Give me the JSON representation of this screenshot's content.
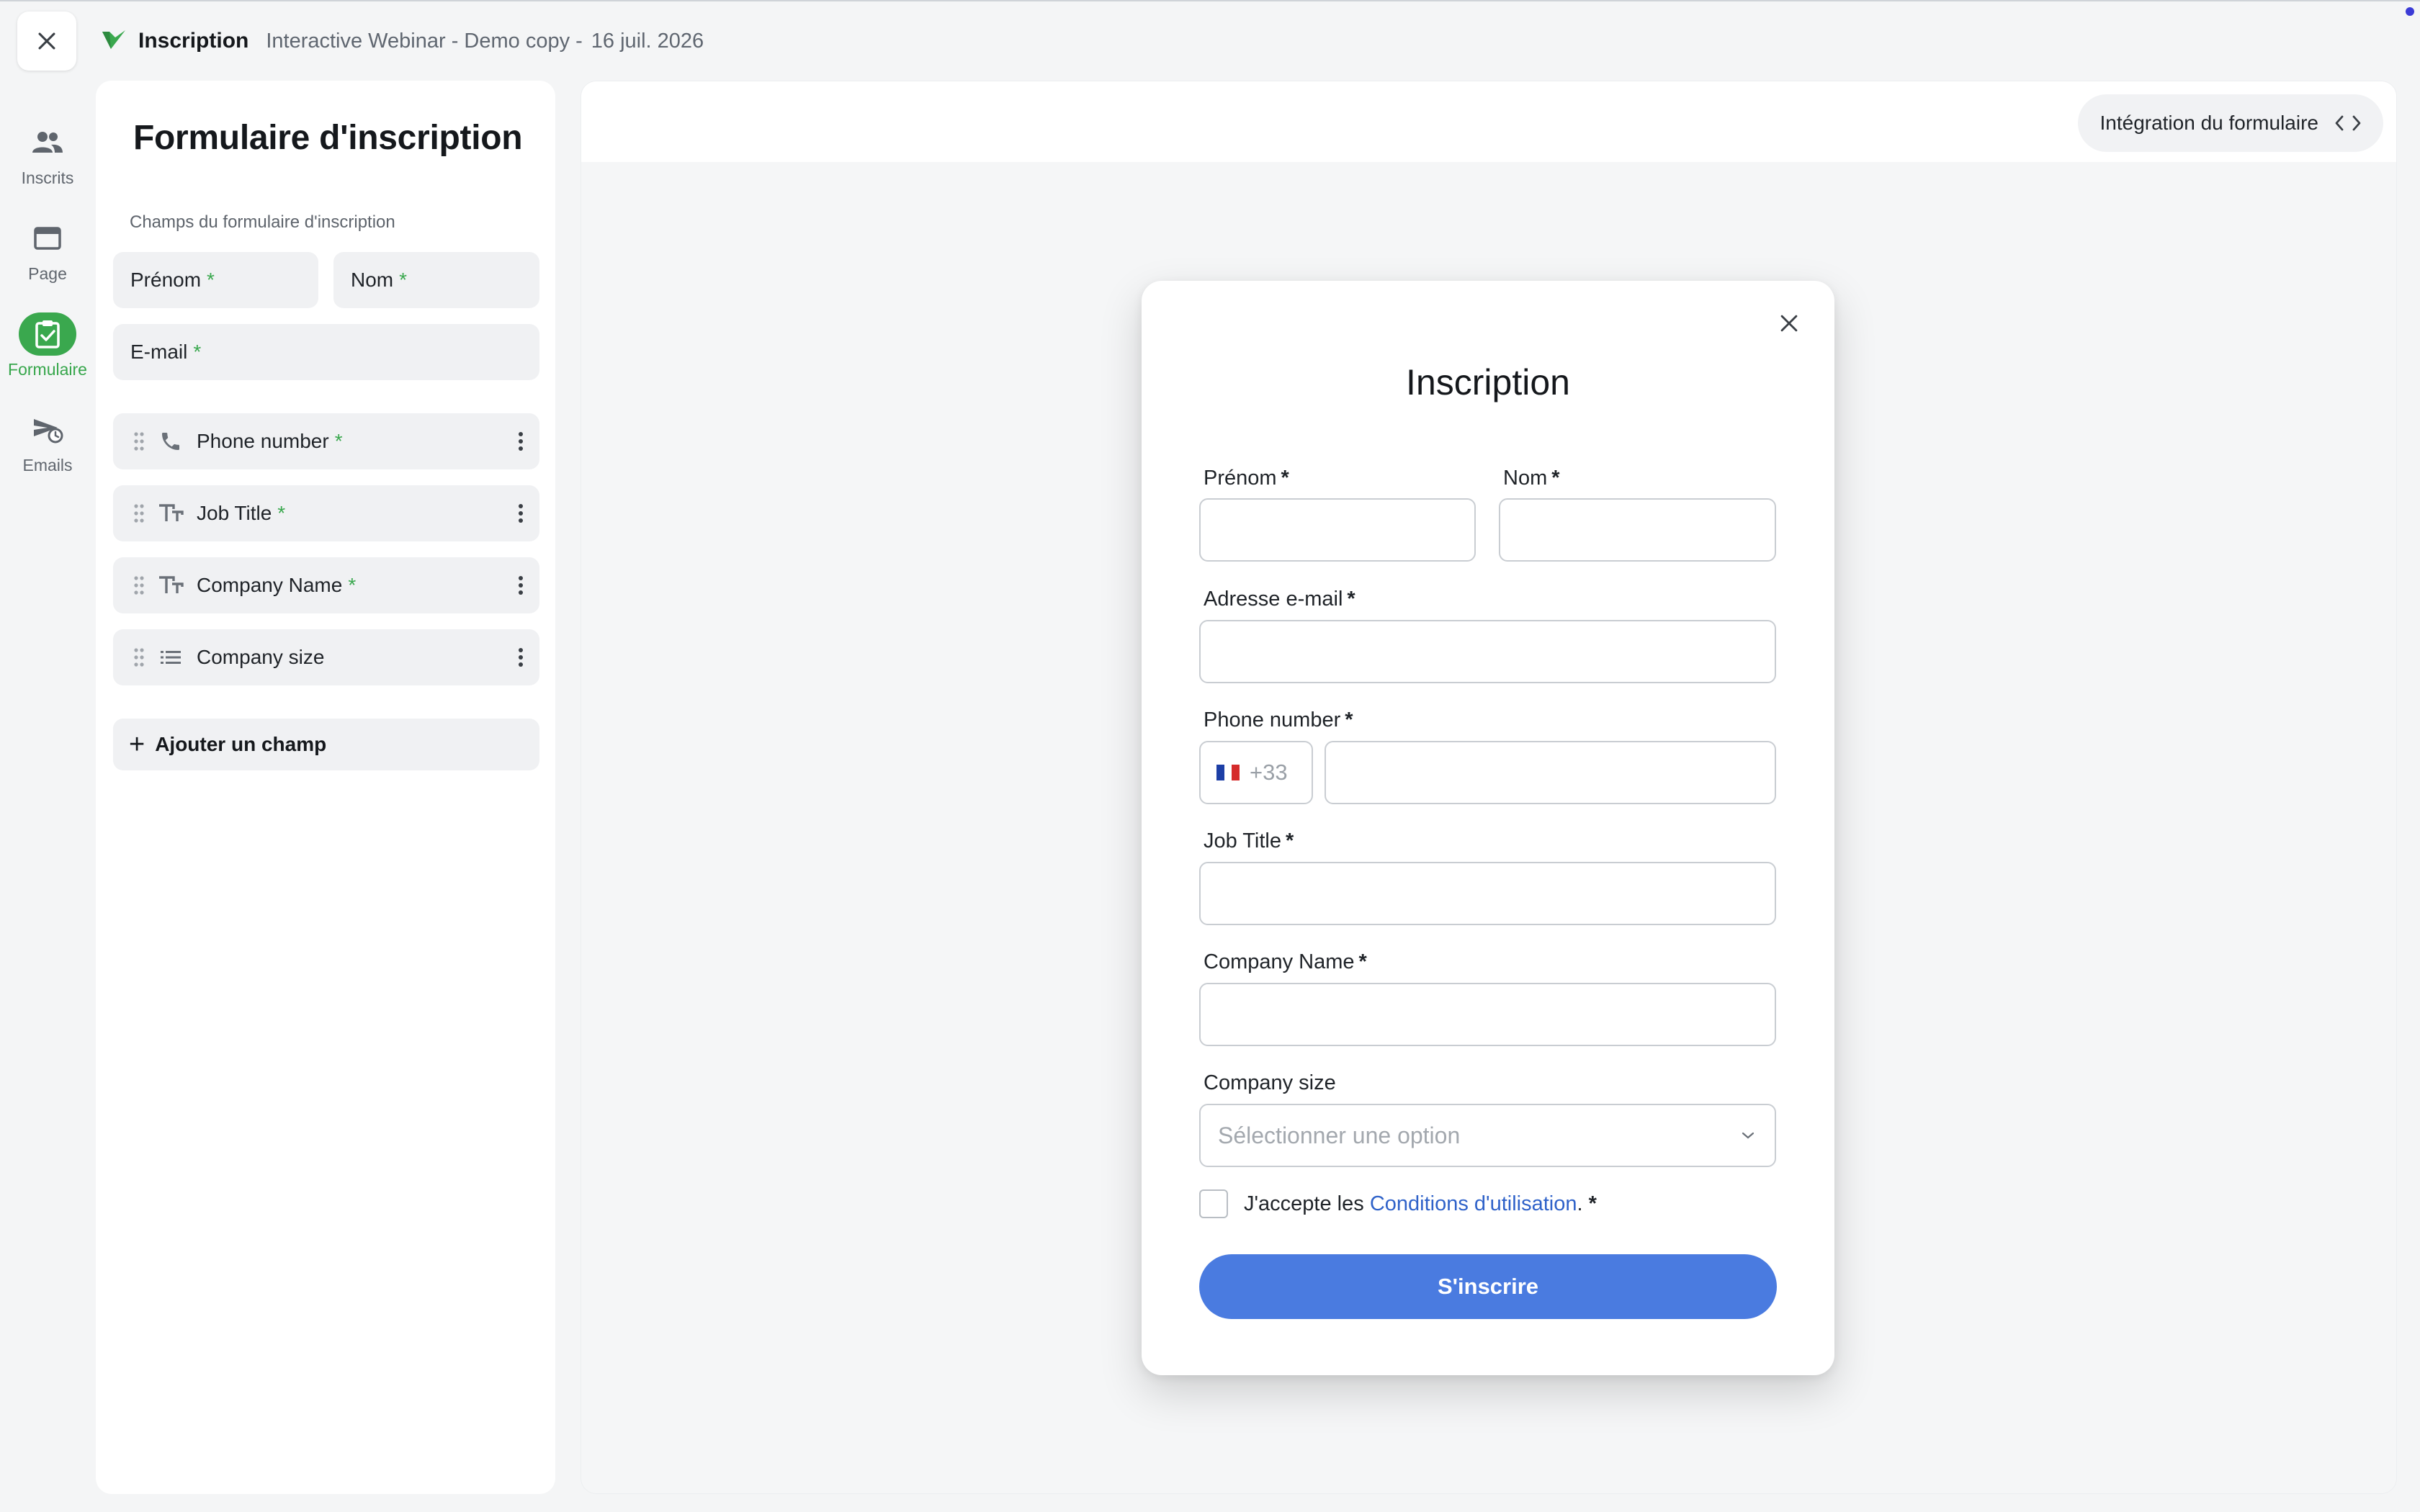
{
  "header": {
    "title": "Inscription",
    "event_name": "Interactive Webinar - Demo copy",
    "separator": "-",
    "date": "16 juil. 2026",
    "brand_color": "#3aa84e"
  },
  "rail": {
    "items": [
      {
        "label": "Inscrits",
        "icon": "people-icon",
        "active": false
      },
      {
        "label": "Page",
        "icon": "window-icon",
        "active": false
      },
      {
        "label": "Formulaire",
        "icon": "clipboard-check-icon",
        "active": true
      },
      {
        "label": "Emails",
        "icon": "send-clock-icon",
        "active": false
      }
    ]
  },
  "panel": {
    "title": "Formulaire d'inscription",
    "section_label": "Champs du formulaire d'inscription",
    "required_marker": "*",
    "base_fields": {
      "first_name": "Prénom",
      "last_name": "Nom",
      "email": "E-mail"
    },
    "custom_fields": [
      {
        "name": "Phone number",
        "type_icon": "phone-icon",
        "required": true
      },
      {
        "name": "Job Title",
        "type_icon": "text-type-icon",
        "required": true
      },
      {
        "name": "Company Name",
        "type_icon": "text-type-icon",
        "required": true
      },
      {
        "name": "Company size",
        "type_icon": "list-icon",
        "required": false
      }
    ],
    "add_field": "Ajouter un champ",
    "add_field_icon": "plus-icon"
  },
  "preview": {
    "embed_button": "Intégration du formulaire",
    "embed_icon": "code-brackets-icon"
  },
  "form": {
    "title": "Inscription",
    "required_marker": "*",
    "first_name_label": "Prénom",
    "last_name_label": "Nom",
    "email_label": "Adresse e-mail",
    "phone_label": "Phone number",
    "phone_prefix": "+33",
    "phone_country_flag": "fr-flag",
    "job_label": "Job Title",
    "company_label": "Company Name",
    "size_label": "Company size",
    "size_placeholder": "Sélectionner une option",
    "terms_prefix": "J'accepte les",
    "terms_link": "Conditions d'utilisation",
    "terms_suffix": ".",
    "submit": "S'inscrire",
    "submit_color": "#4a7be0"
  }
}
